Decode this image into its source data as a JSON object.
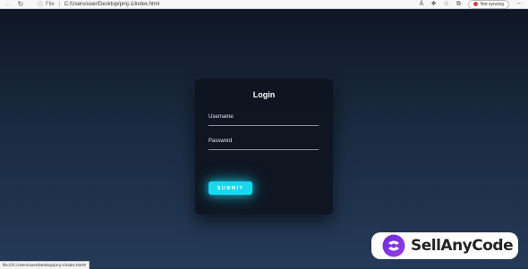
{
  "browser": {
    "back_icon": "arrow-left-icon",
    "refresh_icon": "refresh-icon",
    "site_info_icon": "info-icon",
    "file_label": "File",
    "address": "C:/Users/user/Desktop/proj-1/index.html",
    "read_aloud_icon": "read-aloud-icon",
    "extensions_icon": "extensions-icon",
    "favorites_icon": "star-icon",
    "collections_icon": "collections-icon",
    "sync_label": "Not syncing",
    "more_icon": "more-icon"
  },
  "login": {
    "title": "Login",
    "username_label": "Username",
    "password_label": "Password",
    "submit_label": "SUBMIT"
  },
  "statusbar": {
    "text": "file:///C:/Users/user/Desktop/proj-1/index.html#"
  },
  "watermark": {
    "brand": "SellAnyCode"
  },
  "colors": {
    "accent": "#17d8f0",
    "card": "#0e141e",
    "background_top": "#0f1726",
    "background_bottom": "#243a58"
  }
}
